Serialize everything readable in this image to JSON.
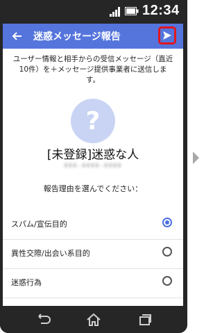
{
  "status_bar": {
    "time": "12:34",
    "icons": [
      "signal-icon",
      "battery-icon"
    ]
  },
  "app_bar": {
    "title": "迷惑メッセージ報告",
    "back_icon": "arrow-left-icon",
    "send_icon": "send-icon",
    "color": "#5575dd",
    "send_highlight_color": "#e0161f"
  },
  "description": "ユーザー情報と相手からの受信メッセージ（直近10件）を＋メッセージ提供事業者に送信します。",
  "contact": {
    "avatar_glyph": "?",
    "name": "[未登録]迷惑な人",
    "number": "080-0000-0000"
  },
  "reason_prompt": "報告理由を選んでください：",
  "options": [
    {
      "label": "スパム/宣伝目的",
      "selected": true
    },
    {
      "label": "異性交際/出会い系目的",
      "selected": false
    },
    {
      "label": "迷惑行為",
      "selected": false
    }
  ],
  "nav_bar": {
    "icons": [
      "back-icon",
      "home-icon",
      "recent-apps-icon"
    ]
  },
  "accent_color": "#4b6fe0"
}
